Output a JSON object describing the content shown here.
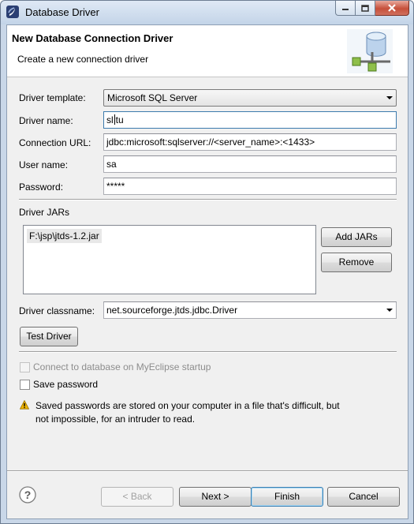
{
  "window": {
    "title": "Database Driver",
    "icon": "eclipse-app-icon"
  },
  "header": {
    "title": "New Database Connection Driver",
    "subtitle": "Create a new connection driver",
    "image": "database-network-icon"
  },
  "form": {
    "driver_template": {
      "label": "Driver template:",
      "value": "Microsoft SQL Server"
    },
    "driver_name": {
      "label": "Driver name:",
      "value_before_caret": "sl",
      "value_after_caret": "tu"
    },
    "connection_url": {
      "label": "Connection URL:",
      "value": "jdbc:microsoft:sqlserver://<server_name>:<1433>"
    },
    "user_name": {
      "label": "User name:",
      "value": "sa"
    },
    "password": {
      "label": "Password:",
      "value": "*****"
    }
  },
  "jars": {
    "label": "Driver JARs",
    "items": [
      "F:\\jsp\\jtds-1.2.jar"
    ],
    "add_label": "Add JARs",
    "remove_label": "Remove"
  },
  "classname": {
    "label": "Driver classname:",
    "value": "net.sourceforge.jtds.jdbc.Driver"
  },
  "test_driver_label": "Test Driver",
  "options": {
    "connect_startup": {
      "label": "Connect to database on MyEclipse startup",
      "checked": false,
      "enabled": false
    },
    "save_password": {
      "label": "Save password",
      "checked": false,
      "enabled": true
    }
  },
  "warning": {
    "line1": "Saved passwords are stored on your computer in a file that's difficult, but",
    "line2": "not impossible, for an intruder to read.",
    "icon": "warning-icon"
  },
  "footer": {
    "help_icon": "help-icon",
    "back_label": "< Back",
    "next_label": "Next >",
    "finish_label": "Finish",
    "cancel_label": "Cancel"
  },
  "colors": {
    "title_bar": "#c3d4e8",
    "close_button": "#c6503a",
    "warning": "#f0b400",
    "default_button_border": "#3c7fb1"
  }
}
